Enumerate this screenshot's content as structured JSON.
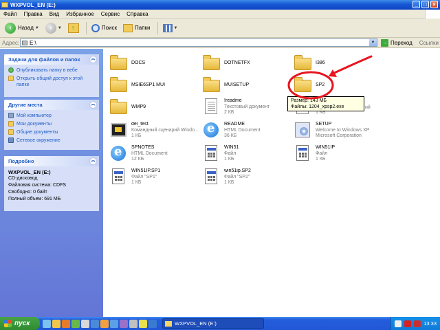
{
  "window": {
    "title": "WXPVOL_EN (E:)",
    "buttons": {
      "minimize": "_",
      "maximize": "□",
      "close": "×"
    }
  },
  "menu": [
    "Файл",
    "Правка",
    "Вид",
    "Избранное",
    "Сервис",
    "Справка"
  ],
  "toolbar": {
    "back_label": "Назад",
    "search_label": "Поиск",
    "folders_label": "Папки"
  },
  "address": {
    "label": "Адрес:",
    "value": "E:\\",
    "go_label": "Переход",
    "links_label": "Ссылки"
  },
  "left_pane": {
    "tasks": {
      "title": "Задачи для файлов и папок",
      "items": [
        {
          "label": "Опубликовать папку в вебе",
          "icon": "publish-web-icon"
        },
        {
          "label": "Открыть общий доступ к этой папке",
          "icon": "share-folder-icon"
        }
      ]
    },
    "places": {
      "title": "Другие места",
      "items": [
        {
          "label": "Мой компьютер",
          "icon": "my-computer-icon"
        },
        {
          "label": "Мои документы",
          "icon": "my-documents-icon"
        },
        {
          "label": "Общие документы",
          "icon": "shared-documents-icon"
        },
        {
          "label": "Сетевое окружение",
          "icon": "network-icon"
        }
      ]
    },
    "details": {
      "title": "Подробно",
      "name": "WXPVOL_EN (E:)",
      "type": "CD-дисковод",
      "filesystem": "Файловая система: CDFS",
      "free": "Свободно: 0 байт",
      "total": "Полный объем: 691 МБ"
    }
  },
  "files": [
    {
      "name": "DOCS",
      "icon": "folder-icon"
    },
    {
      "name": "DOTNETFX",
      "icon": "folder-icon"
    },
    {
      "name": "I386",
      "icon": "folder-icon"
    },
    {
      "name": "MSIE6SP1 MUI",
      "icon": "folder-icon"
    },
    {
      "name": "MUISETUP",
      "icon": "folder-icon"
    },
    {
      "name": "SP2",
      "icon": "folder-icon"
    },
    {
      "name": "WMP9",
      "icon": "folder-icon"
    },
    {
      "name": "!readme",
      "type": "Текстовый документ",
      "size": "2 КБ",
      "icon": "text-document-icon"
    },
    {
      "name": "",
      "type": "",
      "size": "1 КБ",
      "icon": "text-document-icon"
    },
    {
      "name": "del_test",
      "type": "Командный сценарий Windo...",
      "size": "1 КБ",
      "icon": "command-script-icon"
    },
    {
      "name": "README",
      "type": "HTML Document",
      "size": "36 КБ",
      "icon": "internet-explorer-icon"
    },
    {
      "name": "SETUP",
      "type": "Welcome to Windows XP",
      "size": "Microsoft Corporation",
      "icon": "setup-icon"
    },
    {
      "name": "SPNOTES",
      "type": "HTML Document",
      "size": "12 КБ",
      "icon": "internet-explorer-icon"
    },
    {
      "name": "WIN51",
      "type": "Файл",
      "size": "1 КБ",
      "icon": "system-file-icon"
    },
    {
      "name": "WIN51IP",
      "type": "Файл",
      "size": "1 КБ",
      "icon": "system-file-icon"
    },
    {
      "name": "WIN51IP.SP1",
      "type": "Файл \"SP1\"",
      "size": "1 КБ",
      "icon": "system-file-icon"
    },
    {
      "name": "win51ip.SP2",
      "type": "Файл \"SP2\"",
      "size": "1 КБ",
      "icon": "system-file-icon"
    }
  ],
  "tooltip": {
    "size": "Размер: 143 МБ",
    "files": "Файлы: 1204_xpsp2.exe",
    "partial": "ий"
  },
  "taskbar": {
    "start_label": "пуск",
    "task_label": "WXPVOL_EN (E:)",
    "clock": "13:33"
  },
  "colors": {
    "titlebar": "#1657d4",
    "annotation": "#e8141e",
    "leftpane": "#7ba2e7",
    "taskbar": "#245edb",
    "start": "#3a9a3a"
  }
}
